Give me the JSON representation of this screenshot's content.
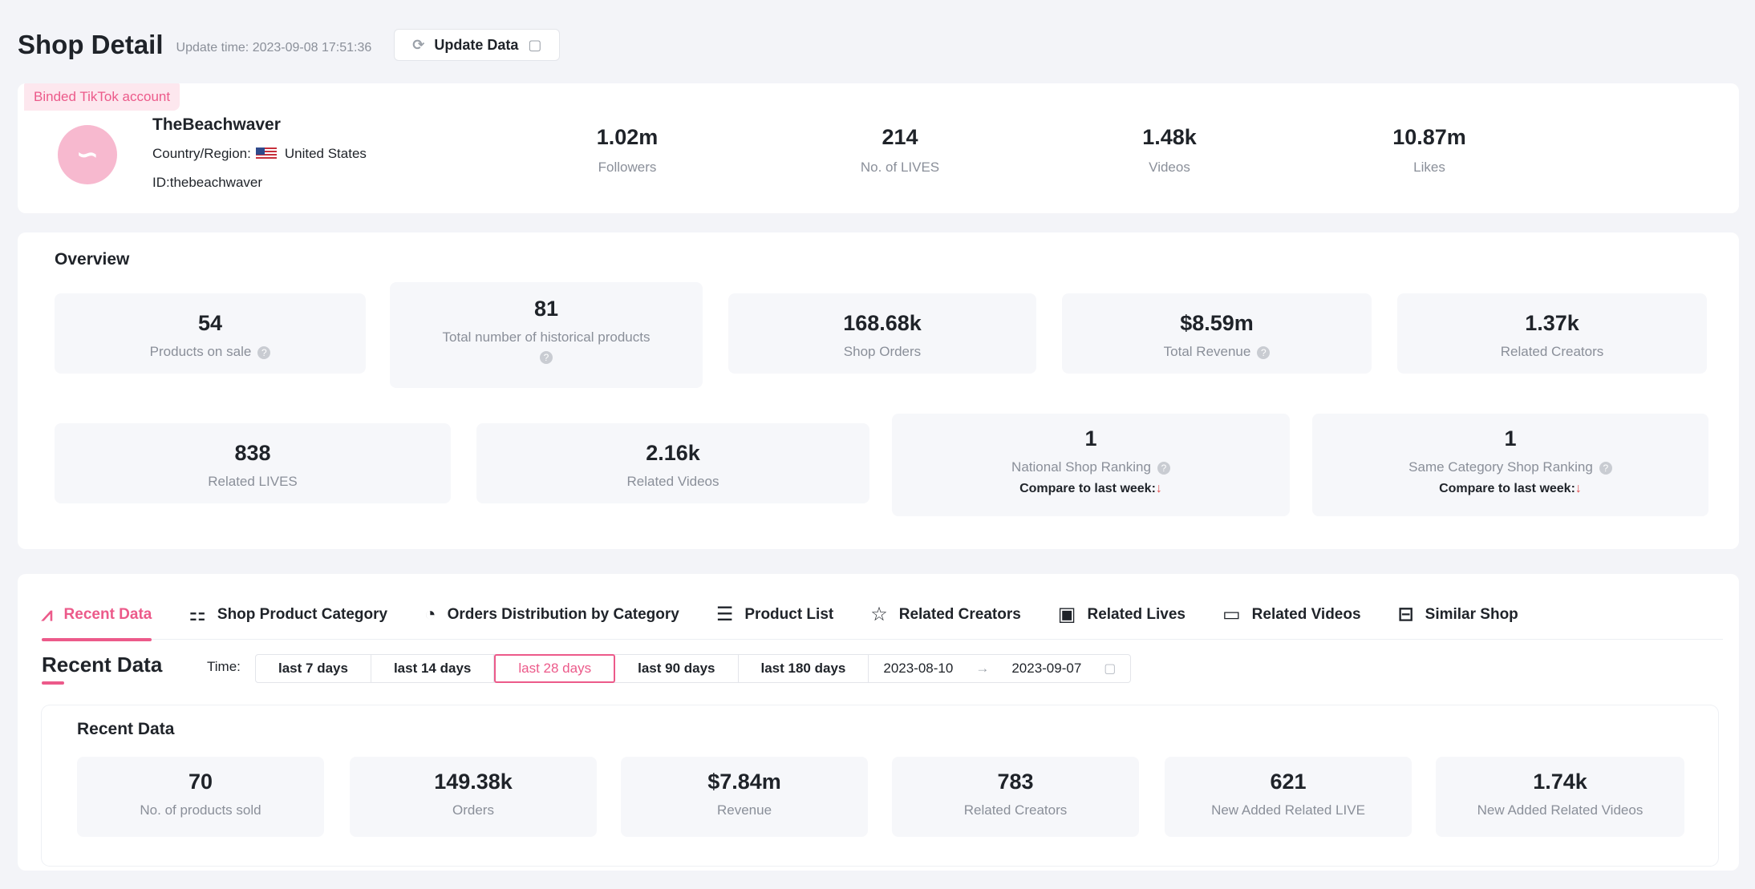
{
  "header": {
    "title": "Shop Detail",
    "update_time": "Update time: 2023-09-08 17:51:36",
    "update_button": "Update Data"
  },
  "account": {
    "tag": "Binded TikTok account",
    "name": "TheBeachwaver",
    "country_label": "Country/Region:",
    "country": "United States",
    "id": "ID:thebeachwaver",
    "stats": [
      {
        "value": "1.02m",
        "label": "Followers"
      },
      {
        "value": "214",
        "label": "No. of LIVES"
      },
      {
        "value": "1.48k",
        "label": "Videos"
      },
      {
        "value": "10.87m",
        "label": "Likes"
      }
    ]
  },
  "overview": {
    "title": "Overview",
    "row1": [
      {
        "value": "54",
        "label": "Products on sale"
      },
      {
        "value": "81",
        "label": "Total number of historical products"
      },
      {
        "value": "168.68k",
        "label": "Shop Orders"
      },
      {
        "value": "$8.59m",
        "label": "Total Revenue"
      },
      {
        "value": "1.37k",
        "label": "Related Creators"
      }
    ],
    "row2": [
      {
        "value": "838",
        "label": "Related LIVES"
      },
      {
        "value": "2.16k",
        "label": "Related Videos"
      },
      {
        "value": "1",
        "label": "National Shop Ranking",
        "compare": "Compare to last week:"
      },
      {
        "value": "1",
        "label": "Same Category Shop Ranking",
        "compare": "Compare to last week:"
      }
    ]
  },
  "tabs": [
    {
      "label": "Recent Data",
      "icon": "line-chart-icon"
    },
    {
      "label": "Shop Product Category",
      "icon": "grid-icon"
    },
    {
      "label": "Orders Distribution by Category",
      "icon": "pie-chart-icon"
    },
    {
      "label": "Product List",
      "icon": "list-icon"
    },
    {
      "label": "Related Creators",
      "icon": "star-icon"
    },
    {
      "label": "Related Lives",
      "icon": "live-icon"
    },
    {
      "label": "Related Videos",
      "icon": "video-icon"
    },
    {
      "label": "Similar Shop",
      "icon": "shop-icon"
    }
  ],
  "recent": {
    "section_title": "Recent Data",
    "time_label": "Time:",
    "time_options": [
      "last 7 days",
      "last 14 days",
      "last 28 days",
      "last 90 days",
      "last 180 days"
    ],
    "date_start": "2023-08-10",
    "date_sep": "→",
    "date_end": "2023-09-07",
    "card_title": "Recent Data",
    "stats": [
      {
        "value": "70",
        "label": "No. of products sold"
      },
      {
        "value": "149.38k",
        "label": "Orders"
      },
      {
        "value": "$7.84m",
        "label": "Revenue"
      },
      {
        "value": "783",
        "label": "Related Creators"
      },
      {
        "value": "621",
        "label": "New Added Related LIVE"
      },
      {
        "value": "1.74k",
        "label": "New Added Related Videos"
      }
    ]
  },
  "colors": {
    "accent": "#ec5a8a",
    "tile_bg": "#f6f7fa",
    "muted": "#8a8f99"
  }
}
